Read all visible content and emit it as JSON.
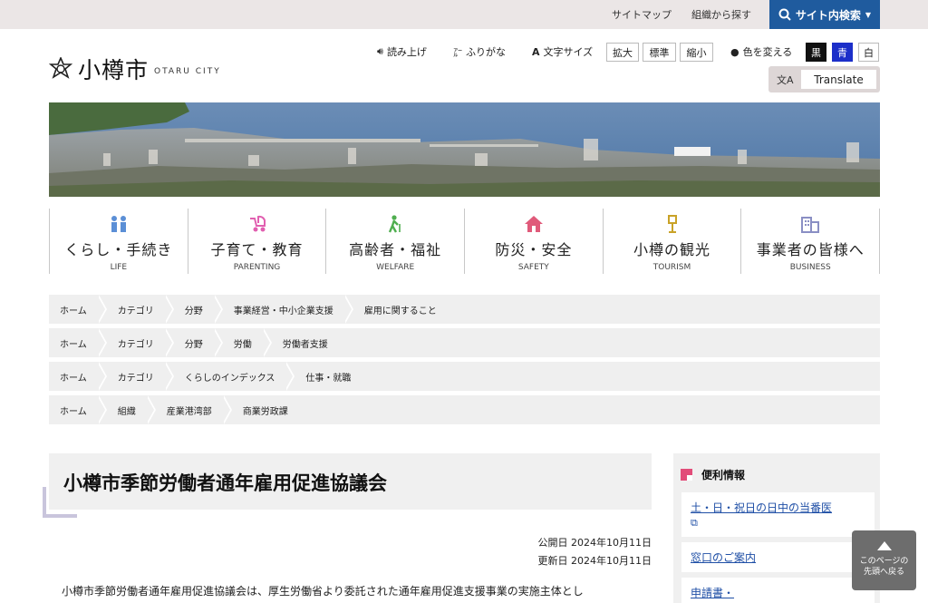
{
  "topbar": {
    "sitemap": "サイトマップ",
    "by_org": "組織から探す",
    "search": "サイト内検索"
  },
  "logo": {
    "name": "小樽市",
    "sub": "OTARU CITY"
  },
  "tools": {
    "read_aloud": "読み上げ",
    "furigana": "ふりがな",
    "font_size": "文字サイズ",
    "enlarge": "拡大",
    "standard": "標準",
    "shrink": "縮小",
    "change_color": "色を変える",
    "color_black": "黒",
    "color_blue": "青",
    "color_white": "白",
    "translate": "Translate"
  },
  "nav": [
    {
      "label": "くらし・手続き",
      "sub": "LIFE",
      "icon": "people-icon",
      "color": "#5b8fd6"
    },
    {
      "label": "子育て・教育",
      "sub": "PARENTING",
      "icon": "stroller-icon",
      "color": "#e15fb0"
    },
    {
      "label": "高齢者・福祉",
      "sub": "WELFARE",
      "icon": "walking-cane-icon",
      "color": "#4fae4f"
    },
    {
      "label": "防災・安全",
      "sub": "SAFETY",
      "icon": "house-icon",
      "color": "#e05a7a"
    },
    {
      "label": "小樽の観光",
      "sub": "TOURISM",
      "icon": "lamp-icon",
      "color": "#c9a227"
    },
    {
      "label": "事業者の皆様へ",
      "sub": "BUSINESS",
      "icon": "building-icon",
      "color": "#8a8fc4"
    }
  ],
  "breadcrumbs": [
    [
      "ホーム",
      "カテゴリ",
      "分野",
      "事業経営・中小企業支援",
      "雇用に関すること"
    ],
    [
      "ホーム",
      "カテゴリ",
      "分野",
      "労働",
      "労働者支援"
    ],
    [
      "ホーム",
      "カテゴリ",
      "くらしのインデックス",
      "仕事・就職"
    ],
    [
      "ホーム",
      "組織",
      "産業港湾部",
      "商業労政課"
    ]
  ],
  "main": {
    "title": "小樽市季節労働者通年雇用促進協議会",
    "published": "公開日 2024年10月11日",
    "updated": "更新日 2024年10月11日",
    "lead": "小樽市季節労働者通年雇用促進協議会は、厚生労働省より委託された通年雇用促進支援事業の実施主体とし"
  },
  "side": {
    "heading": "便利情報",
    "items": [
      "土・日・祝日の日中の当番医",
      "窓口のご案内",
      "申請書・"
    ]
  },
  "totop": {
    "line1": "このページの",
    "line2": "先頭へ戻る"
  }
}
